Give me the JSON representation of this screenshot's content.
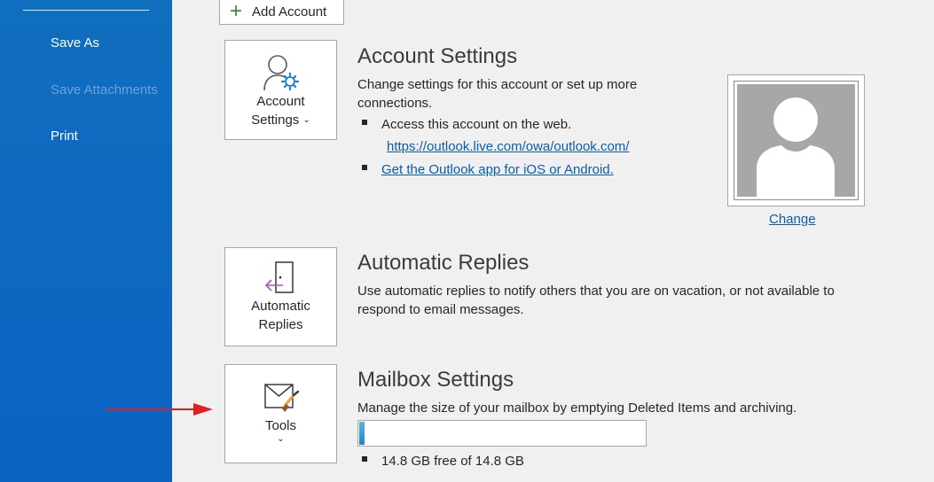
{
  "nav": {
    "items": [
      {
        "label": "Save As",
        "enabled": true
      },
      {
        "label": "Save Attachments",
        "enabled": false
      },
      {
        "label": "Print",
        "enabled": true
      }
    ]
  },
  "add_account": {
    "label": "Add Account",
    "icon": "plus-icon"
  },
  "account_settings": {
    "tile_line1": "Account",
    "tile_line2": "Settings",
    "title": "Account Settings",
    "description": "Change settings for this account or set up more connections.",
    "bullets": [
      {
        "text": "Access this account on the web."
      },
      {
        "link": "https://outlook.live.com/owa/outlook.com/"
      },
      {
        "link": "Get the Outlook app for iOS or Android."
      }
    ],
    "photo_change_label": "Change"
  },
  "automatic_replies": {
    "tile_line1": "Automatic",
    "tile_line2": "Replies",
    "title": "Automatic Replies",
    "description": "Use automatic replies to notify others that you are on vacation, or not available to respond to email messages."
  },
  "mailbox_settings": {
    "tile_label": "Tools",
    "title": "Mailbox Settings",
    "description": "Manage the size of your mailbox by emptying Deleted Items and archiving.",
    "storage_used_fraction": 0.02,
    "storage_text": "14.8 GB free of 14.8 GB"
  },
  "colors": {
    "nav_background": "#0f6cbd",
    "link": "#0a5dad",
    "annotation_arrow": "#e02020"
  }
}
